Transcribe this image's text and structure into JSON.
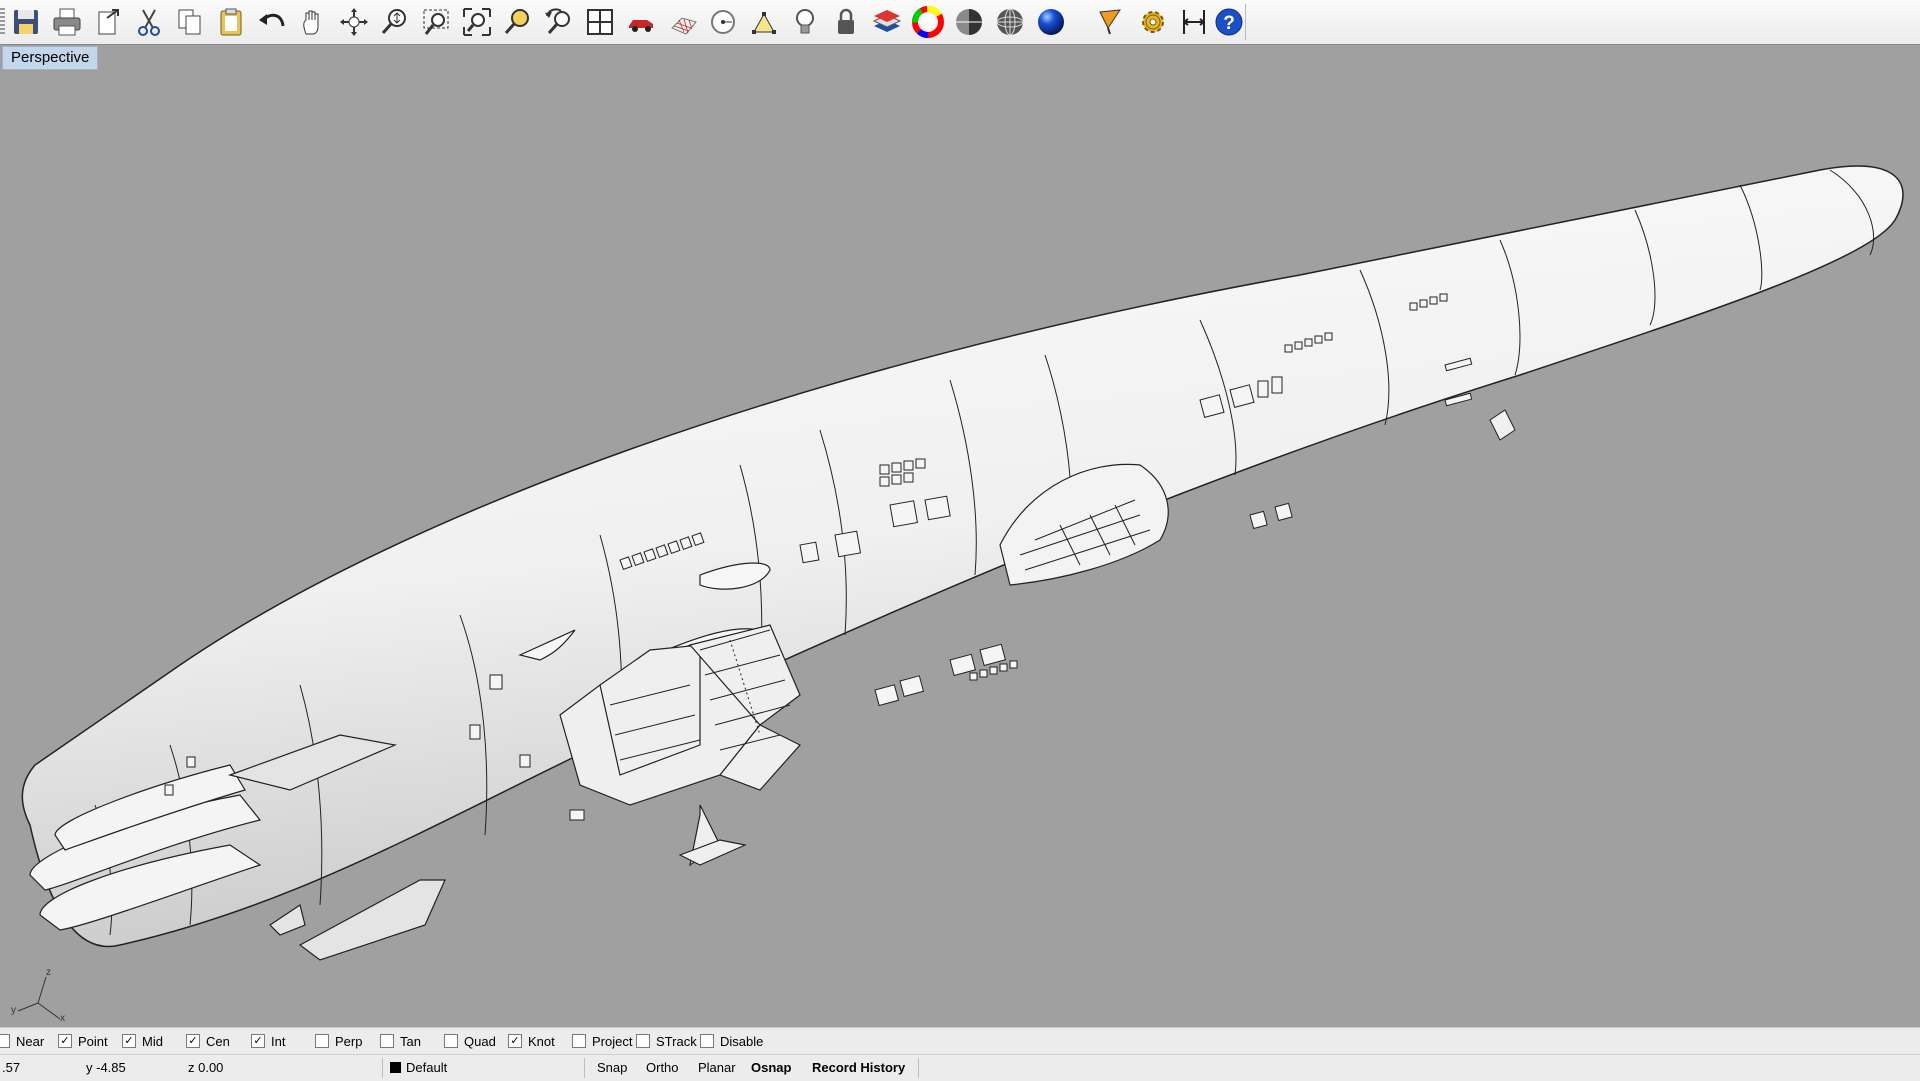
{
  "toolbar": {
    "buttons": [
      {
        "name": "save-icon",
        "title": "Save"
      },
      {
        "name": "print-icon",
        "title": "Print"
      },
      {
        "name": "import-icon",
        "title": "Import"
      },
      {
        "name": "cut-icon",
        "title": "Cut"
      },
      {
        "name": "copy-icon",
        "title": "Copy"
      },
      {
        "name": "paste-icon",
        "title": "Paste"
      },
      {
        "name": "undo-icon",
        "title": "Undo"
      },
      {
        "name": "pan-hand-icon",
        "title": "Pan"
      },
      {
        "name": "rotate-view-icon",
        "title": "Rotate View"
      },
      {
        "name": "zoom-dynamic-icon",
        "title": "Zoom Dynamic"
      },
      {
        "name": "zoom-window-icon",
        "title": "Zoom Window"
      },
      {
        "name": "zoom-extents-icon",
        "title": "Zoom Extents"
      },
      {
        "name": "zoom-selected-icon",
        "title": "Zoom Selected"
      },
      {
        "name": "undo-view-icon",
        "title": "Undo View Change"
      },
      {
        "name": "four-viewports-icon",
        "title": "4 Viewports"
      },
      {
        "name": "car-icon",
        "title": "Named Views"
      },
      {
        "name": "grid-plane-icon",
        "title": "Construction Plane"
      },
      {
        "name": "point-object-icon",
        "title": "Point"
      },
      {
        "name": "select-points-icon",
        "title": "Select"
      },
      {
        "name": "light-bulb-icon",
        "title": "Light"
      },
      {
        "name": "lock-icon",
        "title": "Lock"
      },
      {
        "name": "layers-icon",
        "title": "Layers"
      },
      {
        "name": "color-wheel-icon",
        "title": "Object Properties"
      },
      {
        "name": "shaded-sphere-icon",
        "title": "Shaded"
      },
      {
        "name": "wireframe-sphere-icon",
        "title": "Wireframe"
      },
      {
        "name": "render-sphere-icon",
        "title": "Render"
      },
      {
        "name": "pen-icon",
        "title": "Draw"
      },
      {
        "name": "gear-icon",
        "title": "Options"
      },
      {
        "name": "dimension-icon",
        "title": "Dimension"
      },
      {
        "name": "help-icon",
        "title": "Help"
      }
    ]
  },
  "viewport": {
    "title": "Perspective",
    "axis_labels": {
      "x": "x",
      "y": "y",
      "z": "z"
    }
  },
  "osnap": [
    {
      "label": "Near",
      "checked": false
    },
    {
      "label": "Point",
      "checked": true
    },
    {
      "label": "Mid",
      "checked": true
    },
    {
      "label": "Cen",
      "checked": true
    },
    {
      "label": "Int",
      "checked": true
    },
    {
      "label": "Perp",
      "checked": false
    },
    {
      "label": "Tan",
      "checked": false
    },
    {
      "label": "Quad",
      "checked": false
    },
    {
      "label": "Knot",
      "checked": true
    },
    {
      "label": "Project",
      "checked": false
    },
    {
      "label": "STrack",
      "checked": false
    },
    {
      "label": "Disable",
      "checked": false
    }
  ],
  "status": {
    "x": ".57",
    "y": "y -4.85",
    "z": "z 0.00",
    "layer": "Default",
    "snap": "Snap",
    "ortho": "Ortho",
    "planar": "Planar",
    "osnap": "Osnap",
    "record_history": "Record History"
  },
  "colors": {
    "viewport_bg": "#a0a0a0",
    "title_bg": "#c3d6ea",
    "hull": "#efefef"
  }
}
